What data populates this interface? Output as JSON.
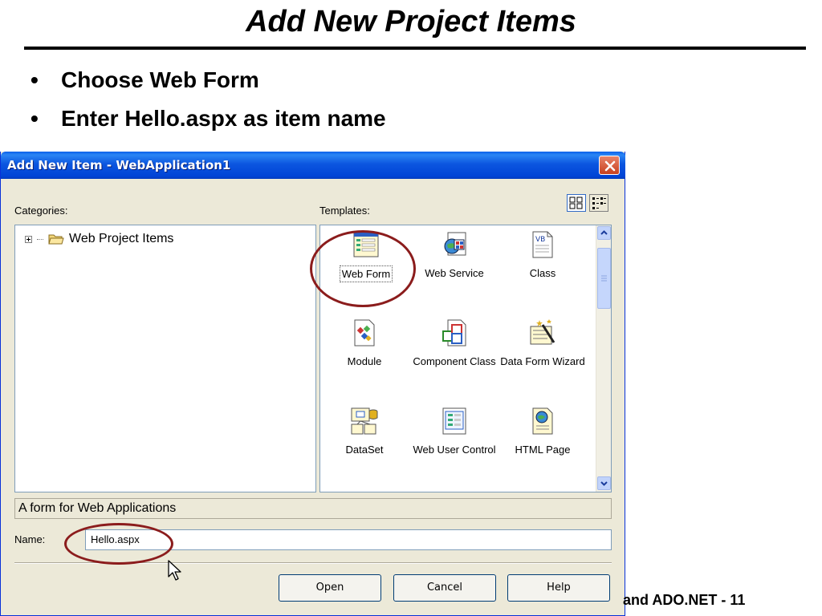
{
  "slide": {
    "title": "Add New Project Items",
    "bullets": [
      "Choose Web Form",
      "Enter Hello.aspx as item name"
    ],
    "bullet_glyph": "•",
    "footer": "and ADO.NET - 11"
  },
  "dialog": {
    "title": "Add New Item - WebApplication1",
    "categories_label": "Categories:",
    "templates_label": "Templates:",
    "categories": [
      {
        "label": "Web Project Items",
        "icon": "folder-open-icon"
      }
    ],
    "templates": [
      {
        "label": "Web Form",
        "icon": "web-form-icon",
        "selected": true
      },
      {
        "label": "Web Service",
        "icon": "web-service-icon"
      },
      {
        "label": "Class",
        "icon": "vb-class-icon"
      },
      {
        "label": "Module",
        "icon": "module-icon"
      },
      {
        "label": "Component Class",
        "icon": "component-class-icon"
      },
      {
        "label": "Data Form Wizard",
        "icon": "data-form-wizard-icon"
      },
      {
        "label": "DataSet",
        "icon": "dataset-icon"
      },
      {
        "label": "Web User Control",
        "icon": "web-user-control-icon"
      },
      {
        "label": "HTML Page",
        "icon": "html-page-icon"
      }
    ],
    "description": "A form for Web Applications",
    "name_label": "Name:",
    "name_value": "Hello.aspx",
    "buttons": {
      "open": "Open",
      "cancel": "Cancel",
      "help": "Help"
    }
  },
  "colors": {
    "titlebar": "#0c56e0",
    "dialog_bg": "#ece9d8",
    "annotation": "#8b1c1c",
    "close_button": "#c8401e"
  }
}
